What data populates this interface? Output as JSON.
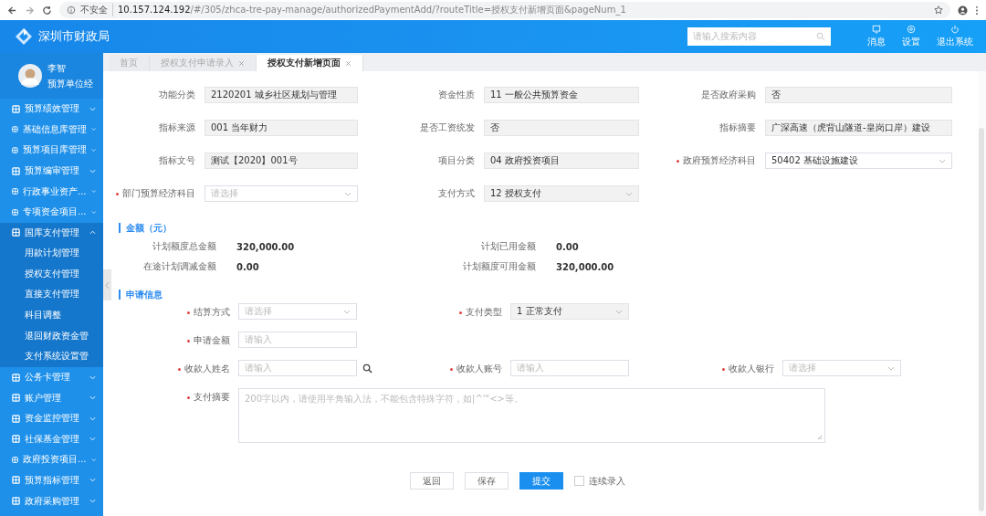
{
  "browser": {
    "security": "不安全",
    "url_host": "10.157.124.192",
    "url_path": "/#/305/zhca-tre-pay-manage/authorizedPaymentAdd/?routeTitle=授权支付新增页面&pageNum_1"
  },
  "header": {
    "title": "深圳市财政局",
    "search": {
      "placeholder": "请输入搜索内容"
    },
    "actions": [
      {
        "kind": "message",
        "label": "消息"
      },
      {
        "kind": "settings",
        "label": "设置"
      },
      {
        "kind": "logout",
        "label": "退出系统"
      }
    ]
  },
  "user": {
    "name": "李智",
    "role": "预算单位经"
  },
  "sidebar": {
    "items": [
      {
        "label": "预算绩效管理",
        "expanded": false
      },
      {
        "label": "基础信息库管理",
        "expanded": false
      },
      {
        "label": "预算项目库管理",
        "expanded": false
      },
      {
        "label": "预算编审管理",
        "expanded": false
      },
      {
        "label": "行政事业资产...",
        "expanded": false
      },
      {
        "label": "专项资金项目...",
        "expanded": false
      },
      {
        "label": "国库支付管理",
        "expanded": true,
        "children": [
          {
            "label": "用款计划管理"
          },
          {
            "label": "授权支付管理"
          },
          {
            "label": "直接支付管理"
          },
          {
            "label": "科目调整"
          },
          {
            "label": "退回财政资金管"
          },
          {
            "label": "支付系统设置管"
          }
        ]
      },
      {
        "label": "公务卡管理",
        "expanded": false
      },
      {
        "label": "账户管理",
        "expanded": false
      },
      {
        "label": "资金监控管理",
        "expanded": false
      },
      {
        "label": "社保基金管理",
        "expanded": false
      },
      {
        "label": "政府投资项目...",
        "expanded": false
      },
      {
        "label": "预算指标管理",
        "expanded": false
      },
      {
        "label": "政府采购管理",
        "expanded": false
      }
    ]
  },
  "tabs": [
    {
      "label": "首页",
      "selected": false,
      "closable": false
    },
    {
      "label": "授权支付申请录入",
      "selected": false,
      "closable": true
    },
    {
      "label": "授权支付新增页面",
      "selected": true,
      "closable": true
    }
  ],
  "basic_fields": [
    [
      {
        "label": "功能分类",
        "kind": "readonly",
        "required": false,
        "value": "2120201 城乡社区规划与管理"
      },
      {
        "label": "资金性质",
        "kind": "readonly",
        "required": false,
        "value": "11 一般公共预算资金"
      },
      {
        "label": "是否政府采购",
        "kind": "readonly",
        "required": false,
        "value": "否"
      }
    ],
    [
      {
        "label": "指标来源",
        "kind": "readonly",
        "required": false,
        "value": "001 当年财力"
      },
      {
        "label": "是否工资统发",
        "kind": "readonly",
        "required": false,
        "value": "否"
      },
      {
        "label": "指标摘要",
        "kind": "readonly",
        "required": false,
        "value": "广深高速（虎背山隧道-皇岗口岸）建设"
      }
    ],
    [
      {
        "label": "指标文号",
        "kind": "readonly",
        "required": false,
        "value": "测试【2020】001号"
      },
      {
        "label": "项目分类",
        "kind": "readonly",
        "required": false,
        "value": "04 政府投资项目"
      },
      {
        "label": "政府预算经济科目",
        "kind": "select",
        "required": true,
        "value": "50402 基础设施建设"
      }
    ],
    [
      {
        "label": "部门预算经济科目",
        "kind": "select",
        "required": true,
        "placeholder": "请选择"
      },
      {
        "label": "支付方式",
        "kind": "readonly-select",
        "required": false,
        "value": "12 授权支付"
      }
    ]
  ],
  "amount_section": {
    "title": "金额（元）",
    "rows": [
      [
        {
          "label": "计划额度总金额",
          "value": "320,000.00"
        },
        {
          "label": "计划已用金额",
          "value": "0.00"
        }
      ],
      [
        {
          "label": "在途计划调减金额",
          "value": "0.00"
        },
        {
          "label": "计划额度可用金额",
          "value": "320,000.00"
        }
      ]
    ]
  },
  "apply_section": {
    "title": "申请信息",
    "rows": [
      [
        {
          "label": "结算方式",
          "kind": "select",
          "required": true,
          "placeholder": "请选择"
        },
        {
          "label": "支付类型",
          "kind": "readonly-select",
          "required": true,
          "value": "1 正常支付"
        }
      ],
      [
        {
          "label": "申请金额",
          "kind": "input",
          "required": true,
          "placeholder": "请输入"
        }
      ],
      [
        {
          "label": "收款人姓名",
          "kind": "input",
          "required": true,
          "placeholder": "请输入",
          "search": true
        },
        {
          "label": "收款人账号",
          "kind": "input",
          "required": true,
          "placeholder": "请输入"
        },
        {
          "label": "收款人银行",
          "kind": "select",
          "required": true,
          "placeholder": "请选择"
        }
      ],
      [
        {
          "label": "支付摘要",
          "kind": "textarea",
          "required": true,
          "placeholder": "200字以内，请使用半角输入法，不能包含特殊字符，如|^'\"<>等。"
        }
      ]
    ]
  },
  "buttons": [
    {
      "label": "返回",
      "kind": "default"
    },
    {
      "label": "保存",
      "kind": "default"
    },
    {
      "label": "提交",
      "kind": "primary"
    }
  ],
  "continuous_entry": {
    "label": "连续录入",
    "checked": false
  }
}
